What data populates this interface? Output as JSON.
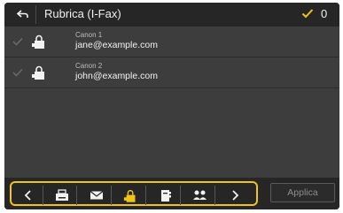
{
  "header": {
    "title": "Rubrica (I-Fax)",
    "selected_count": "0",
    "accent_color": "#f0c419"
  },
  "entries": [
    {
      "name": "Canon 1",
      "address": "jane@example.com",
      "checked": false,
      "icon": "locked-address-book-icon"
    },
    {
      "name": "Canon 2",
      "address": "john@example.com",
      "checked": false,
      "icon": "locked-address-book-icon"
    }
  ],
  "toolbar": {
    "buttons": [
      {
        "icon": "chevron-left-icon"
      },
      {
        "icon": "fax-icon"
      },
      {
        "icon": "email-icon"
      },
      {
        "icon": "locked-address-book-icon",
        "selected": true
      },
      {
        "icon": "phone-book-icon"
      },
      {
        "icon": "group-icon"
      },
      {
        "icon": "chevron-right-icon"
      }
    ],
    "apply_label": "Applica"
  }
}
